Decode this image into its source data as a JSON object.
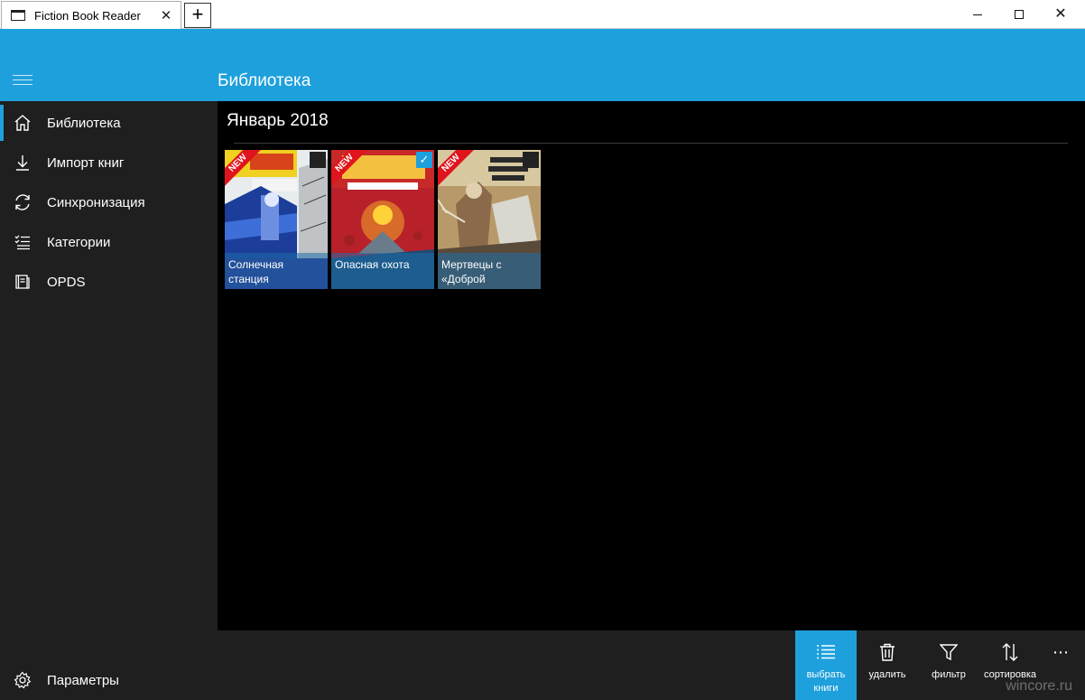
{
  "window": {
    "tab_title": "Fiction Book Reader",
    "tab_close": "✕",
    "new_tab": "+",
    "close_glyph": "✕"
  },
  "header": {
    "title": "Библиотека"
  },
  "sidebar": {
    "items": [
      {
        "label": "Библиотека",
        "icon": "home-icon",
        "active": true
      },
      {
        "label": "Импорт книг",
        "icon": "download-icon"
      },
      {
        "label": "Синхронизация",
        "icon": "sync-icon"
      },
      {
        "label": "Категории",
        "icon": "list-check-icon"
      },
      {
        "label": "OPDS",
        "icon": "catalog-icon"
      }
    ],
    "settings_label": "Параметры"
  },
  "main": {
    "group_title": "Январь 2018",
    "books": [
      {
        "title": "Солнечная станция",
        "badge": "NEW",
        "selected": false
      },
      {
        "title": "Опасная охота",
        "badge": "NEW",
        "selected": true
      },
      {
        "title": "Мертвецы с «Доброй надежды»",
        "badge": "NEW",
        "selected": false
      }
    ],
    "check_glyph": "✓"
  },
  "commands": {
    "select_books": "выбрать книги",
    "delete": "удалить",
    "filter": "фильтр",
    "sort": "сортировка",
    "more": "⋯"
  },
  "watermark": "wincore.ru",
  "colors": {
    "accent": "#1ea0dc",
    "sidebar_bg": "#1f1f1f",
    "badge_red": "#e0141c"
  }
}
